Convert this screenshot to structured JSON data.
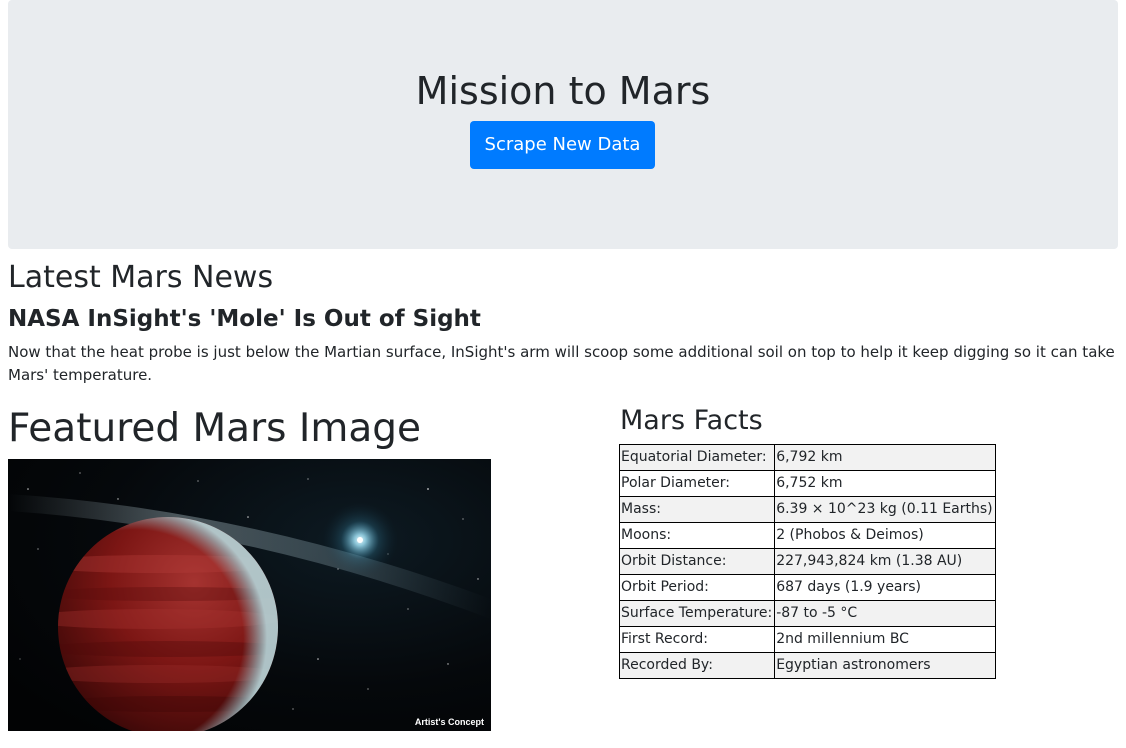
{
  "header": {
    "title": "Mission to Mars",
    "scrape_button_label": "Scrape New Data"
  },
  "news": {
    "section_heading": "Latest Mars News",
    "title": "NASA InSight's 'Mole' Is Out of Sight",
    "paragraph": "Now that the heat probe is just below the Martian surface, InSight's arm will scoop some additional soil on top to help it keep digging so it can take Mars' temperature."
  },
  "featured_image": {
    "section_heading": "Featured Mars Image",
    "caption": "Artist's Concept"
  },
  "facts": {
    "section_heading": "Mars Facts",
    "rows": [
      {
        "label": "Equatorial Diameter:",
        "value": "6,792 km"
      },
      {
        "label": "Polar Diameter:",
        "value": "6,752 km"
      },
      {
        "label": "Mass:",
        "value": "6.39 × 10^23 kg (0.11 Earths)"
      },
      {
        "label": "Moons:",
        "value": "2 (Phobos & Deimos)"
      },
      {
        "label": "Orbit Distance:",
        "value": "227,943,824 km (1.38 AU)"
      },
      {
        "label": "Orbit Period:",
        "value": "687 days (1.9 years)"
      },
      {
        "label": "Surface Temperature:",
        "value": "-87 to -5 °C"
      },
      {
        "label": "First Record:",
        "value": "2nd millennium BC"
      },
      {
        "label": "Recorded By:",
        "value": "Egyptian astronomers"
      }
    ]
  },
  "colors": {
    "jumbotron_bg": "#e9ecef",
    "primary_button": "#007bff",
    "table_stripe": "#f2f2f2"
  }
}
